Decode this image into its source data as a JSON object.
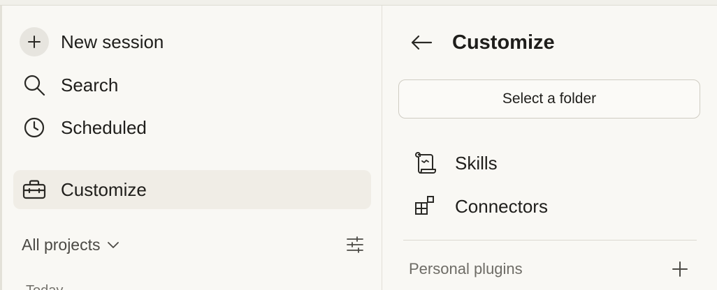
{
  "sidebar": {
    "items": [
      {
        "label": "New session",
        "icon": "plus-icon"
      },
      {
        "label": "Search",
        "icon": "search-icon"
      },
      {
        "label": "Scheduled",
        "icon": "clock-icon"
      },
      {
        "label": "Customize",
        "icon": "toolbox-icon",
        "active": true
      }
    ],
    "projects_label": "All projects",
    "filter_icon": "filter-sliders-icon",
    "section_today": "Today"
  },
  "panel": {
    "title": "Customize",
    "back_icon": "arrow-left-icon",
    "folder_button": "Select a folder",
    "items": [
      {
        "label": "Skills",
        "icon": "scroll-icon"
      },
      {
        "label": "Connectors",
        "icon": "blocks-icon"
      }
    ],
    "plugins_label": "Personal plugins",
    "plugins_add_icon": "plus-icon"
  },
  "colors": {
    "background": "#f9f8f4",
    "active_bg": "#f0ede6",
    "text": "#1f1e1b",
    "muted": "#6e6c66"
  }
}
